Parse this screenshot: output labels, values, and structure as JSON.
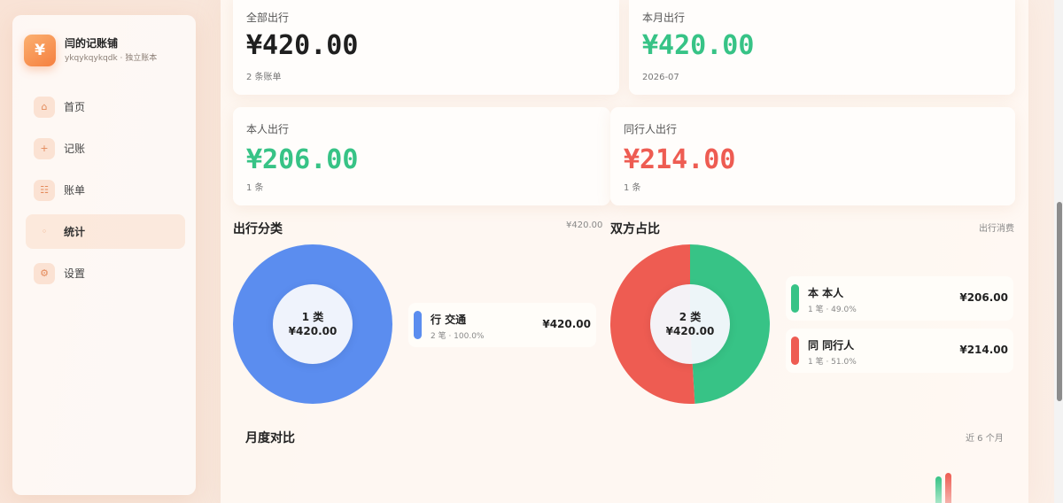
{
  "brand": {
    "logo": "¥",
    "name": "闫的记账铺",
    "subtitle": "ykqykqykqdk · 独立账本"
  },
  "nav": [
    {
      "label": "首页",
      "icon": "home-icon",
      "glyph": "⌂"
    },
    {
      "label": "记账",
      "icon": "plus-icon",
      "glyph": "+"
    },
    {
      "label": "账单",
      "icon": "list-icon",
      "glyph": "☷"
    },
    {
      "label": "统计",
      "icon": "chart-icon",
      "glyph": "◦",
      "active": true
    },
    {
      "label": "设置",
      "icon": "gear-icon",
      "glyph": "⚙"
    }
  ],
  "cards": {
    "total": {
      "label": "全部出行",
      "value": "¥420.00",
      "sub": "2 条账单"
    },
    "month": {
      "label": "本月出行",
      "value": "¥420.00",
      "sub": "2026-07"
    },
    "self": {
      "label": "本人出行",
      "value": "¥206.00",
      "sub": "1 条"
    },
    "companion": {
      "label": "同行人出行",
      "value": "¥214.00",
      "sub": "1 条"
    }
  },
  "category": {
    "title": "出行分类",
    "total": "¥420.00",
    "center_count": "1 类",
    "center_amount": "¥420.00",
    "items": [
      {
        "name": "行 交通",
        "meta": "2 笔 · 100.0%",
        "amount": "¥420.00"
      }
    ]
  },
  "share": {
    "title": "双方占比",
    "right": "出行消费",
    "center_count": "2 类",
    "center_amount": "¥420.00",
    "items": [
      {
        "name": "本 本人",
        "meta": "1 笔 · 49.0%",
        "amount": "¥206.00"
      },
      {
        "name": "同 同行人",
        "meta": "1 笔 · 51.0%",
        "amount": "¥214.00"
      }
    ]
  },
  "monthly": {
    "title": "月度对比",
    "right": "近 6 个月"
  },
  "colors": {
    "green": "#37c386",
    "red": "#ee5c52",
    "blue": "#5b8def",
    "accent": "#f57f3f"
  },
  "chart_data": [
    {
      "type": "pie",
      "title": "出行分类",
      "categories": [
        "行 交通"
      ],
      "values": [
        420.0
      ]
    },
    {
      "type": "pie",
      "title": "双方占比",
      "categories": [
        "本 本人",
        "同 同行人"
      ],
      "values": [
        206.0,
        214.0
      ]
    }
  ]
}
